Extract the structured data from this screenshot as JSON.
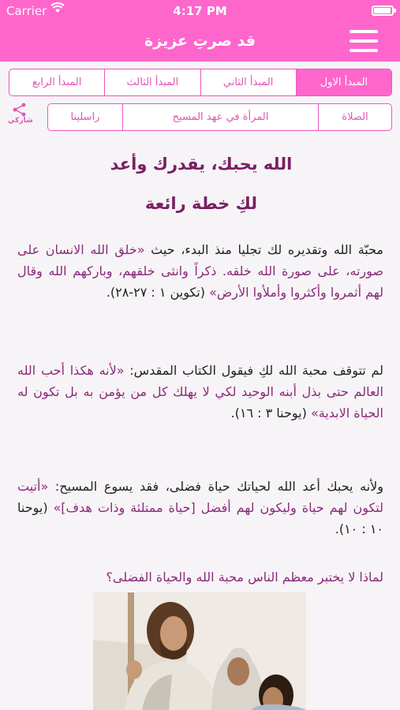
{
  "status": {
    "carrier": "Carrier",
    "time": "4:17 PM"
  },
  "nav": {
    "title": "قد صرتِ عزيزة"
  },
  "tabs": [
    "المبدأ الاول",
    "المبدأ الثاني",
    "المبدأ الثالث",
    "المبدأ الرابع"
  ],
  "subtabs": [
    "الصلاة",
    "المرأة في عهد المسيح",
    "راسلينا"
  ],
  "share": {
    "label": "شاركي"
  },
  "heading": {
    "line1": "الله يحبك، يقدرك وأعد",
    "line2": "لكِ خطة رائعة"
  },
  "paragraphs": {
    "p1_a": "محبّة الله وتقديره لك تجليا منذ البدء، حيث ",
    "p1_b": "«خلق الله الانسان على صورته، على صورة الله خلقه. ذكراً وانثى خلقهم، وباركهم الله وقال لهم أثمروا وأكثروا وأملأوا الأرض»",
    "p1_c": " (تكوين ١ : ٢٧-٢٨).",
    "p2_a": "لم تتوقف محبة الله لكِ فيقول الكتاب المقدس: ",
    "p2_b": "«لأنه هكذا أحب الله العالم حتى بذل أبنه الوحيد لكي لا يهلك كل من يؤمن به بل تكون له الحياة الابدية»",
    "p2_c": " (يوحنا ٣ : ١٦).",
    "p3_a": "ولأنه يحبك أعد الله لحياتك حياة فضلى، فقد يسوع المسيح: ",
    "p3_b": "«أتيت لتكون لهم حياة وليكون لهم أفضل [حياة ممتلئة وذات هدف]»",
    "p3_c": " (يوحنا ١٠ : ١٠)."
  },
  "question": "لماذا لا يختبر معظم الناس محبة الله والحياة الفضلى؟",
  "colors": {
    "accent": "#ff66cc",
    "heading": "#7a1f63",
    "verse": "#8a2a7a"
  },
  "icons": {
    "menu": "hamburger-menu-icon",
    "share": "share-icon",
    "wifi": "wifi-icon",
    "battery": "battery-icon"
  }
}
